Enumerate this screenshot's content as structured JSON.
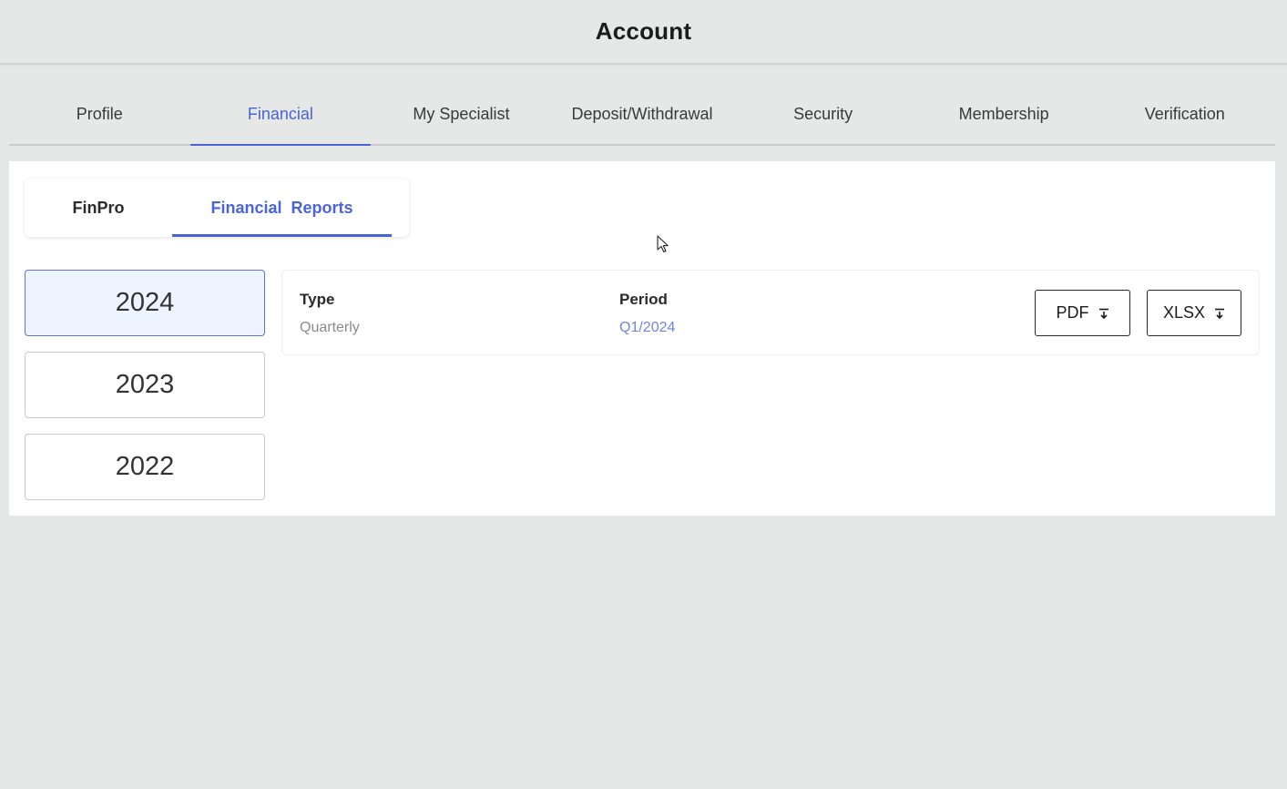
{
  "header": {
    "title": "Account"
  },
  "main_tabs": [
    {
      "label": "Profile"
    },
    {
      "label": "Financial",
      "active": true
    },
    {
      "label": "My Specialist"
    },
    {
      "label": "Deposit/Withdrawal"
    },
    {
      "label": "Security"
    },
    {
      "label": "Membership"
    },
    {
      "label": "Verification"
    }
  ],
  "sub_tabs": [
    {
      "label": "FinPro"
    },
    {
      "label": "Financial  Reports",
      "active": true
    }
  ],
  "years": [
    {
      "label": "2024",
      "selected": true
    },
    {
      "label": "2023"
    },
    {
      "label": "2022"
    }
  ],
  "report": {
    "type_label": "Type",
    "type_value": "Quarterly",
    "period_label": "Period",
    "period_value": "Q1/2024",
    "pdf_label": "PDF",
    "xlsx_label": "XLSX",
    "download_icon": "download-icon"
  },
  "colors": {
    "accent": "#4a64d8",
    "selected_bg": "#eef4ff",
    "page_bg": "#e6e7e7"
  }
}
